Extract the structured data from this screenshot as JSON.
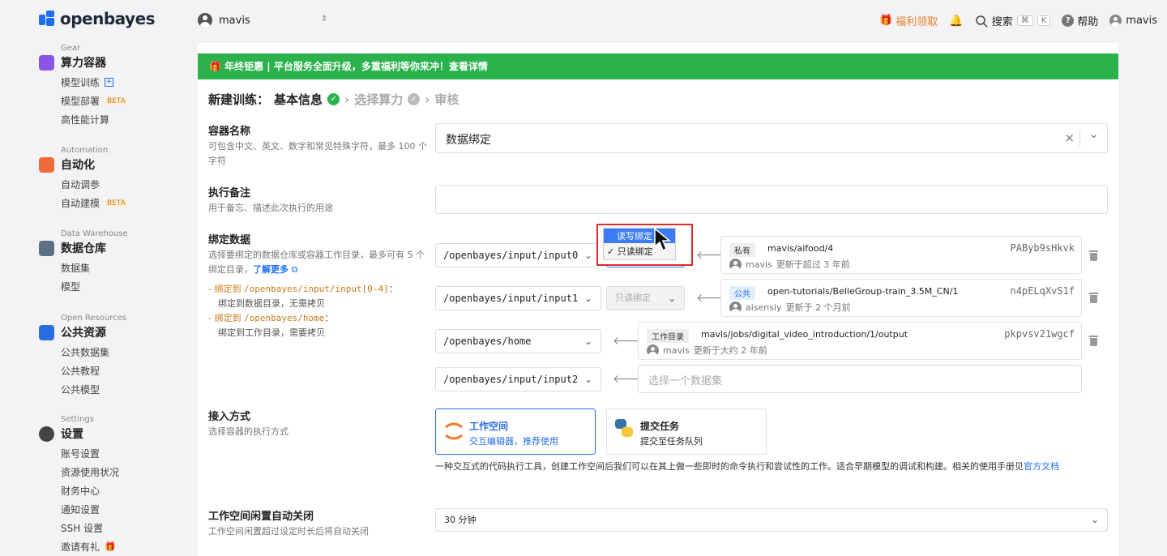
{
  "brand": {
    "name": "openbayes",
    "color": "#1e6ff1"
  },
  "topbar": {
    "user_switch": "mavis",
    "benefit": "福利领取",
    "search": "搜索",
    "kbd_cmd": "⌘",
    "kbd_k": "K",
    "help": "帮助",
    "user": "mavis"
  },
  "sidebar": {
    "gear": {
      "category": "Gear",
      "title": "算力容器",
      "items": [
        "模型训练",
        "模型部署",
        "高性能计算"
      ],
      "beta": "BETA"
    },
    "automation": {
      "category": "Automation",
      "title": "自动化",
      "items": [
        "自动调参",
        "自动建模"
      ],
      "beta": "BETA"
    },
    "warehouse": {
      "category": "Data Warehouse",
      "title": "数据仓库",
      "items": [
        "数据集",
        "模型"
      ]
    },
    "open": {
      "category": "Open Resources",
      "title": "公共资源",
      "items": [
        "公共数据集",
        "公共教程",
        "公共模型"
      ]
    },
    "settings": {
      "category": "Settings",
      "title": "设置",
      "items": [
        "账号设置",
        "资源使用状况",
        "财务中心",
        "通知设置",
        "SSH 设置",
        "邀请有礼"
      ]
    }
  },
  "banner": {
    "text": "🎁 年终钜惠 | 平台服务全面升级，多重福利等你来冲！查看详情",
    "color": "#2bb24c"
  },
  "steps": {
    "prefix": "新建训练：",
    "step1": "基本信息",
    "step2": "选择算力",
    "step3": "审核",
    "sep": "›"
  },
  "form": {
    "name_label": "容器名称",
    "name_desc": "可包含中文、英文、数字和常见特殊字符，最多 100 个字符",
    "name_value": "数据绑定",
    "note_label": "执行备注",
    "note_desc": "用于备忘、描述此次执行的用途",
    "bind_label": "绑定数据",
    "bind_desc": "选择要绑定的数据仓库或容器工作目录，最多可有 5 个绑定目录，",
    "bind_more": "了解更多",
    "rule1_a": "- 绑定到 ",
    "rule1_code": "/openbayes/input/input[0-4]",
    "rule1_b": "：",
    "rule1_desc": "绑定到数据目录，无需拷贝",
    "rule2_a": "- 绑定到 ",
    "rule2_code": "/openbayes/home",
    "rule2_b": "：",
    "rule2_desc": "绑定到工作目录，需要拷贝",
    "access_label": "接入方式",
    "access_desc": "选择容器的执行方式",
    "idle_label": "工作空间闲置自动关闭",
    "idle_desc": "工作空间闲置超过设定时长后将自动关闭",
    "idle_value": "30 分钟"
  },
  "bindings": [
    {
      "path": "/openbayes/input/input0",
      "mode": "",
      "tag": "私有",
      "dataset": "mavis/aifood/4",
      "owner": "mavis",
      "updated": "更新于超过 3 年前",
      "id": "PAByb9sHkvk"
    },
    {
      "path": "/openbayes/input/input1",
      "mode": "只读绑定",
      "tag": "公共",
      "dataset": "open-tutorials/BelleGroup-train_3.5M_CN/1",
      "owner": "aisensiy",
      "updated": "更新于 2 个月前",
      "id": "n4pELqXvS1f"
    },
    {
      "path": "/openbayes/home",
      "mode": "",
      "tag": "工作目录",
      "dataset": "mavis/jobs/digital_video_introduction/1/output",
      "owner": "mavis",
      "updated": "更新于大约 2 年前",
      "id": "pkpvsv21wgcf"
    },
    {
      "path": "/openbayes/input/input2",
      "placeholder": "选择一个数据集"
    }
  ],
  "bind_menu": {
    "options": [
      "读写绑定",
      "只读绑定"
    ],
    "checked": "✓"
  },
  "modes": [
    {
      "title": "工作空间",
      "desc": "交互编辑器，推荐使用"
    },
    {
      "title": "提交任务",
      "desc": "提交至任务队列"
    }
  ],
  "mode_help": "一种交互式的代码执行工具，创建工作空间后我们可以在其上做一些即时的命令执行和尝试性的工作。适合早期模型的调试和构建。相关的使用手册见",
  "mode_help_link": "官方文档",
  "icons": {
    "clear": "×",
    "chevron": "⌄",
    "arrow": "🡐"
  }
}
